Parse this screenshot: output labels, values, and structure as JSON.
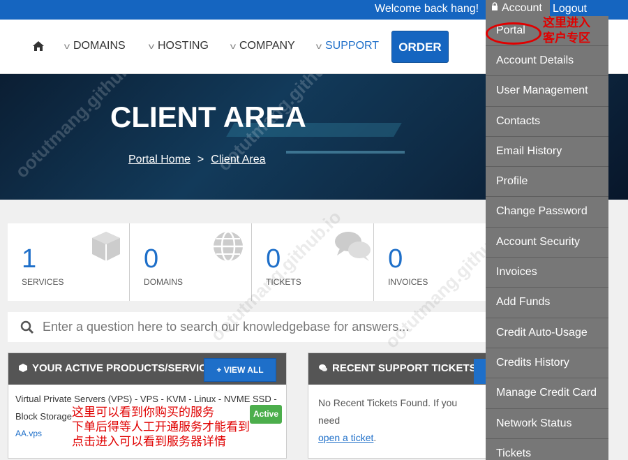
{
  "topbar": {
    "welcome": "Welcome back hang!",
    "account": "Account",
    "logout": "Logout"
  },
  "nav": {
    "items": [
      {
        "label": "DOMAINS"
      },
      {
        "label": "HOSTING"
      },
      {
        "label": "COMPANY"
      },
      {
        "label": "SUPPORT"
      }
    ],
    "order": "ORDER"
  },
  "hero": {
    "title": "CLIENT AREA",
    "crumb_home": "Portal Home",
    "crumb_sep": ">",
    "crumb_current": "Client Area"
  },
  "stats": [
    {
      "value": "1",
      "label": "SERVICES"
    },
    {
      "value": "0",
      "label": "DOMAINS"
    },
    {
      "value": "0",
      "label": "TICKETS"
    },
    {
      "value": "0",
      "label": "INVOICES"
    }
  ],
  "search": {
    "placeholder": "Enter a question here to search our knowledgebase for answers..."
  },
  "products": {
    "title": "YOUR ACTIVE PRODUCTS/SERVICES",
    "view_all": "+ VIEW ALL",
    "line1": "Virtual Private Servers (VPS) - VPS - KVM - Linux - NVME SSD -",
    "line2": "Block Storage",
    "domain": "AA.vps",
    "status": "Active"
  },
  "tickets": {
    "title": "RECENT SUPPORT TICKETS",
    "empty": "No Recent Tickets Found. If you need",
    "link": "open a ticket",
    "link_end": "."
  },
  "dropdown": [
    "Portal",
    "Account Details",
    "User Management",
    "Contacts",
    "Email History",
    "Profile",
    "Change Password",
    "Account Security",
    "Invoices",
    "Add Funds",
    "Credit Auto-Usage",
    "Credits History",
    "Manage Credit Card",
    "Network Status",
    "Tickets"
  ],
  "annotations": {
    "top_line1": "这里进入",
    "top_line2": "客户专区",
    "product_line1": "这里可以看到你购买的服务",
    "product_line2": "下单后得等人工开通服务才能看到",
    "product_line3": "点击进入可以看到服务器详情"
  },
  "watermark": "ootutmang.github.io",
  "colors": {
    "primary": "#1565c0",
    "dropdown": "#777777",
    "annotation": "#e00000",
    "active": "#4cae4c"
  }
}
